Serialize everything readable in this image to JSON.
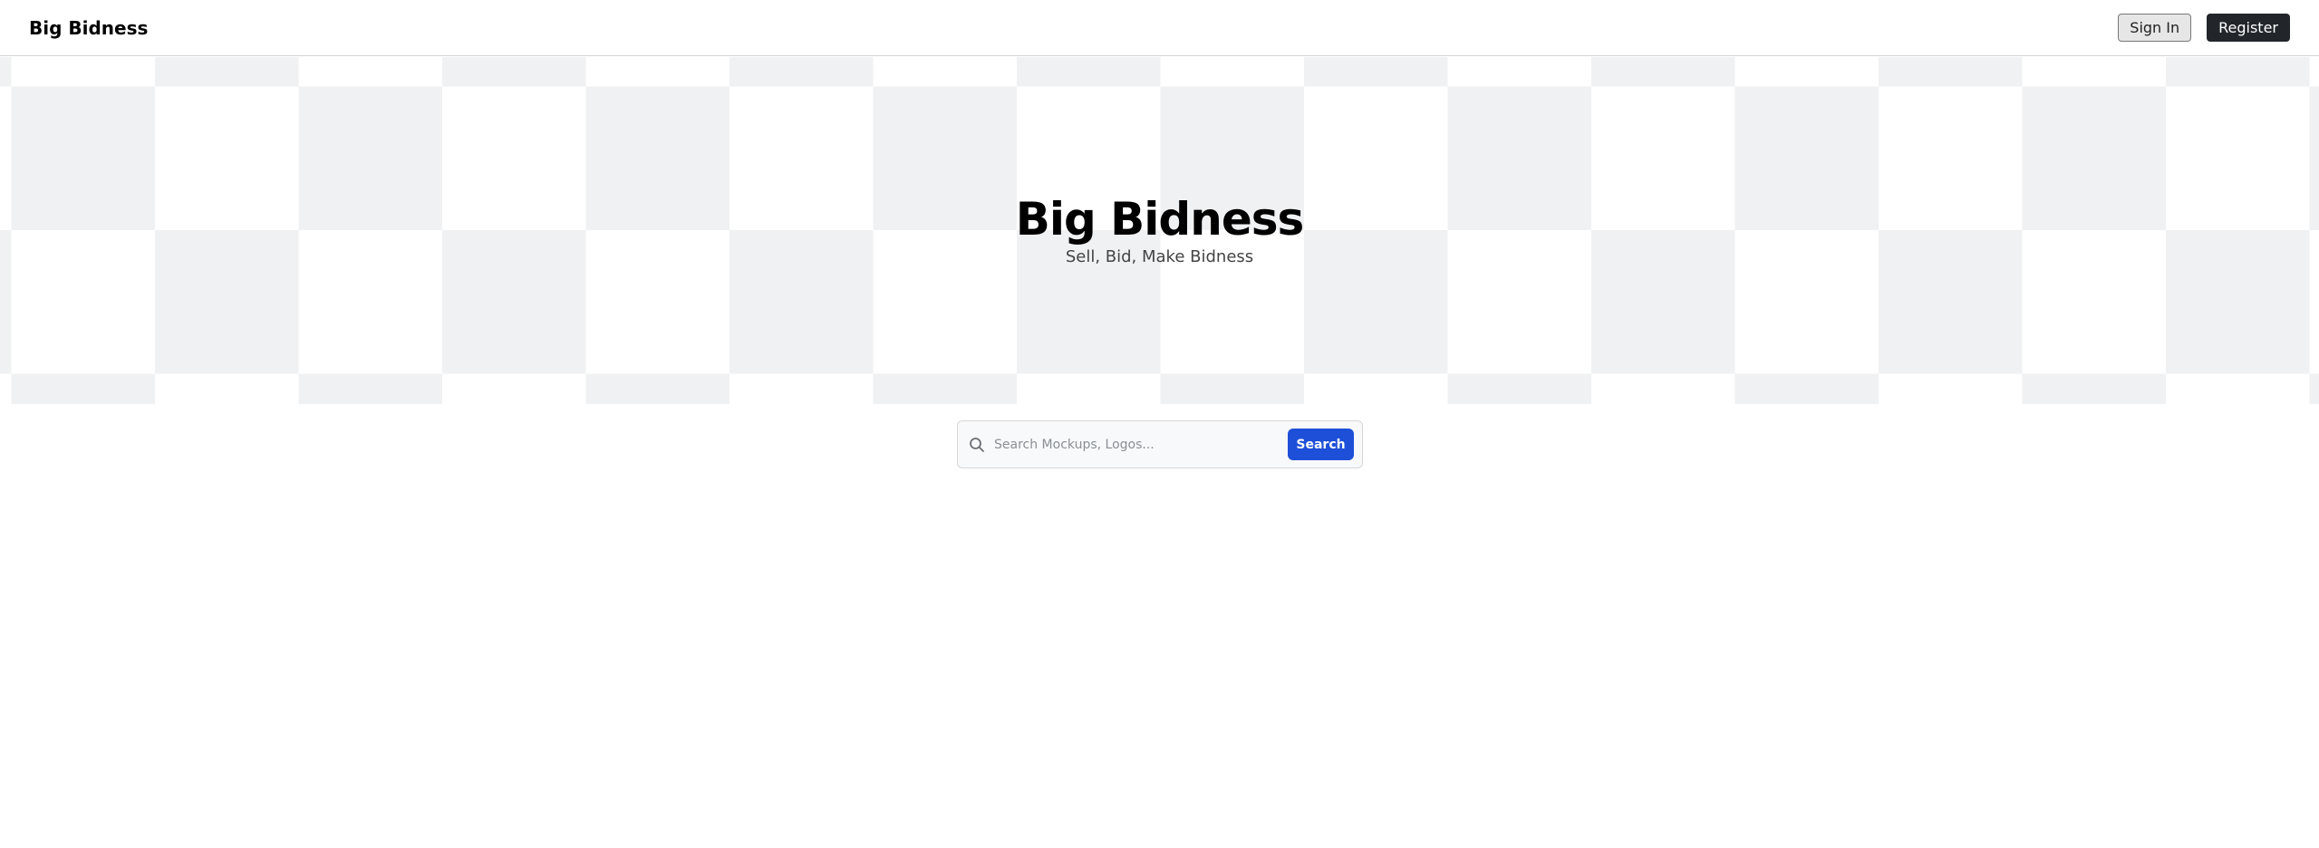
{
  "navbar": {
    "brand": "Big Bidness",
    "sign_in_label": "Sign In",
    "register_label": "Register"
  },
  "hero": {
    "title": "Big Bidness",
    "subtitle": "Sell, Bid, Make Bidness",
    "checker_colors": [
      "#ffffff",
      "#f0f1f2"
    ]
  },
  "search": {
    "placeholder": "Search Mockups, Logos...",
    "value": "",
    "button_label": "Search",
    "icon": "search-icon",
    "button_color": "#1d4fd8"
  }
}
